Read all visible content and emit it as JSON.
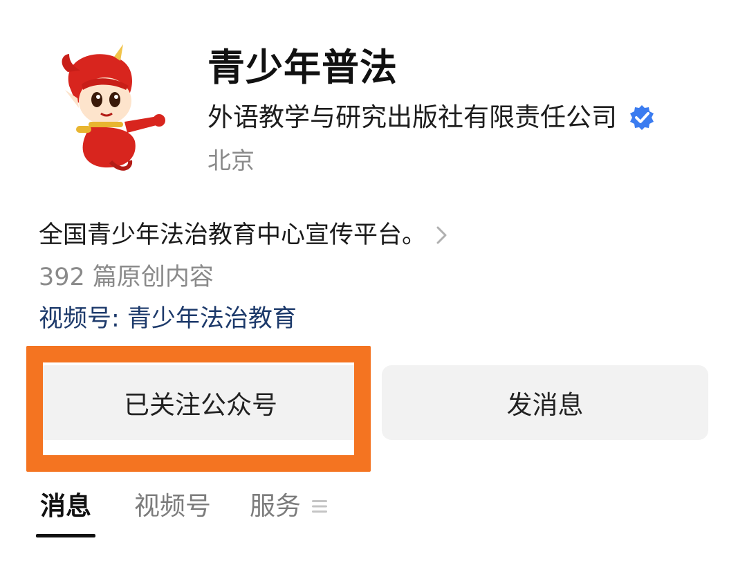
{
  "profile": {
    "name": "青少年普法",
    "owner": "外语教学与研究出版社有限责任公司",
    "location": "北京",
    "intro": "全国青少年法治教育中心宣传平台。",
    "original_count": "392 篇原创内容",
    "channels_link": "视频号: 青少年法治教育",
    "verified_icon": "verified-check-icon",
    "avatar_icon": "cartoon-mascot-avatar"
  },
  "actions": {
    "follow_label": "已关注公众号",
    "message_label": "发消息"
  },
  "tabs": [
    {
      "label": "消息",
      "active": true
    },
    {
      "label": "视频号",
      "active": false
    },
    {
      "label": "服务",
      "active": false,
      "icon": "menu-icon"
    }
  ],
  "colors": {
    "highlight": "#f47421",
    "verified": "#3b7cf0",
    "link": "#1d3a6b",
    "button_bg": "#f2f2f2"
  }
}
